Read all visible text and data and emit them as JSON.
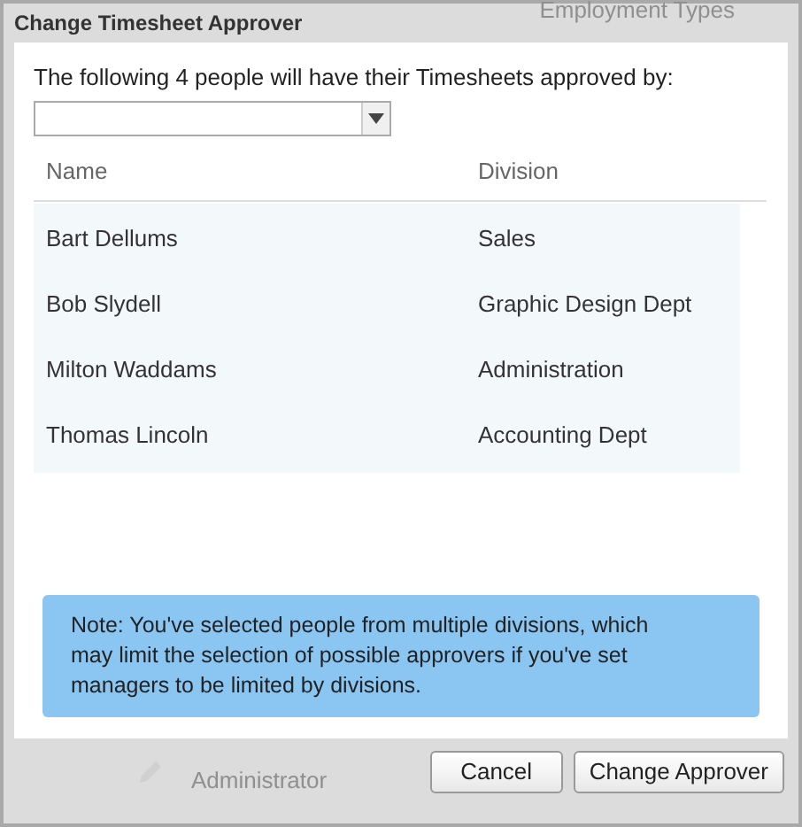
{
  "background": {
    "top_text": "Employment Types",
    "bottom_text": "Administrator"
  },
  "dialog": {
    "title": "Change Timesheet Approver",
    "prompt": "The following 4 people will have their Timesheets approved by:",
    "table": {
      "columns": [
        "Name",
        "Division"
      ],
      "rows": [
        {
          "name": "Bart Dellums",
          "division": "Sales"
        },
        {
          "name": "Bob Slydell",
          "division": "Graphic Design Dept"
        },
        {
          "name": "Milton Waddams",
          "division": "Administration"
        },
        {
          "name": "Thomas Lincoln",
          "division": "Accounting Dept"
        }
      ]
    },
    "note": "Note: You've selected people from multiple divisions, which may limit the selection of possible approvers if you've set managers to be limited by divisions.",
    "buttons": [
      "Cancel",
      "Change Approver"
    ]
  }
}
